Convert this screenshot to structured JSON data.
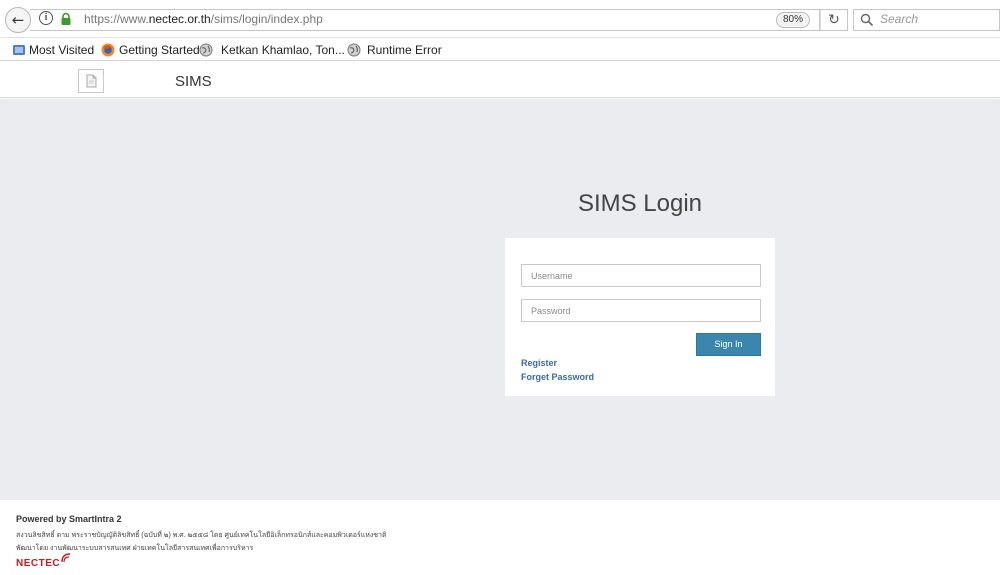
{
  "browser": {
    "url_prefix": "https://www.",
    "url_domain": "nectec.or.th",
    "url_path": "/sims/login/index.php",
    "zoom": "80%",
    "search_placeholder": "Search",
    "bookmarks": [
      {
        "label": "Most Visited",
        "icon": "bookmark-folder-icon"
      },
      {
        "label": "Getting Started",
        "icon": "firefox-icon"
      },
      {
        "label": "Ketkan Khamlao, Ton...",
        "icon": "globe-icon"
      },
      {
        "label": "Runtime Error",
        "icon": "globe-icon"
      }
    ]
  },
  "header": {
    "brand": "SIMS"
  },
  "login": {
    "title": "SIMS Login",
    "username_placeholder": "Username",
    "password_placeholder": "Password",
    "signin_label": "Sign In",
    "register_label": "Register",
    "forget_label": "Forget Password",
    "accent_color": "#3a87ad"
  },
  "footer": {
    "powered_by": "Powered by SmartIntra 2",
    "line1": "สงวนลิขสิทธิ์ ตาม พระราชบัญญัติลิขสิทธิ์ (ฉบับที่ ๒) พ.ศ. ๒๕๕๘ โดย ศูนย์เทคโนโลยีอิเล็กทรอนิกส์และคอมพิวเตอร์แห่งชาติ",
    "line2": "พัฒนาโดย งานพัฒนาระบบสารสนเทศ ฝ่ายเทคโนโลยีสารสนเทศเพื่อการบริหาร",
    "logo_text": "NECTEC"
  }
}
